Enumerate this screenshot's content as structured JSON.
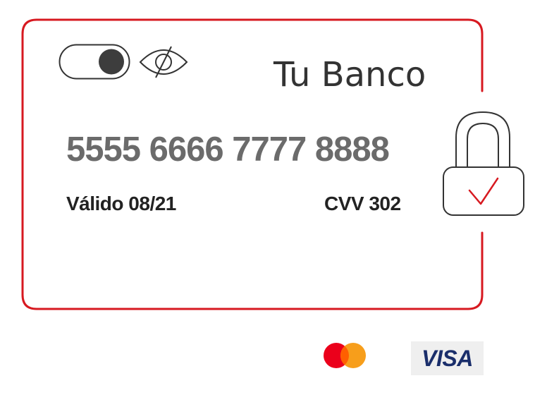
{
  "card": {
    "bank_name": "Tu Banco",
    "number": "5555 6666 7777 8888",
    "valid_label": "Válido 08/21",
    "cvv_label": "CVV 302",
    "visibility_toggle_state": "on"
  },
  "brands": {
    "visa_text": "VISA"
  },
  "icons": {
    "toggle": "toggle-switch-icon",
    "eye": "eye-slash-icon",
    "lock": "padlock-check-icon",
    "mastercard": "mastercard-logo"
  },
  "colors": {
    "accent": "#d71920",
    "text_dark": "#333333",
    "card_number": "#6b6b6b",
    "mastercard_red": "#eb001b",
    "mastercard_orange": "#f79e1b",
    "visa_blue": "#1a2e6b"
  }
}
